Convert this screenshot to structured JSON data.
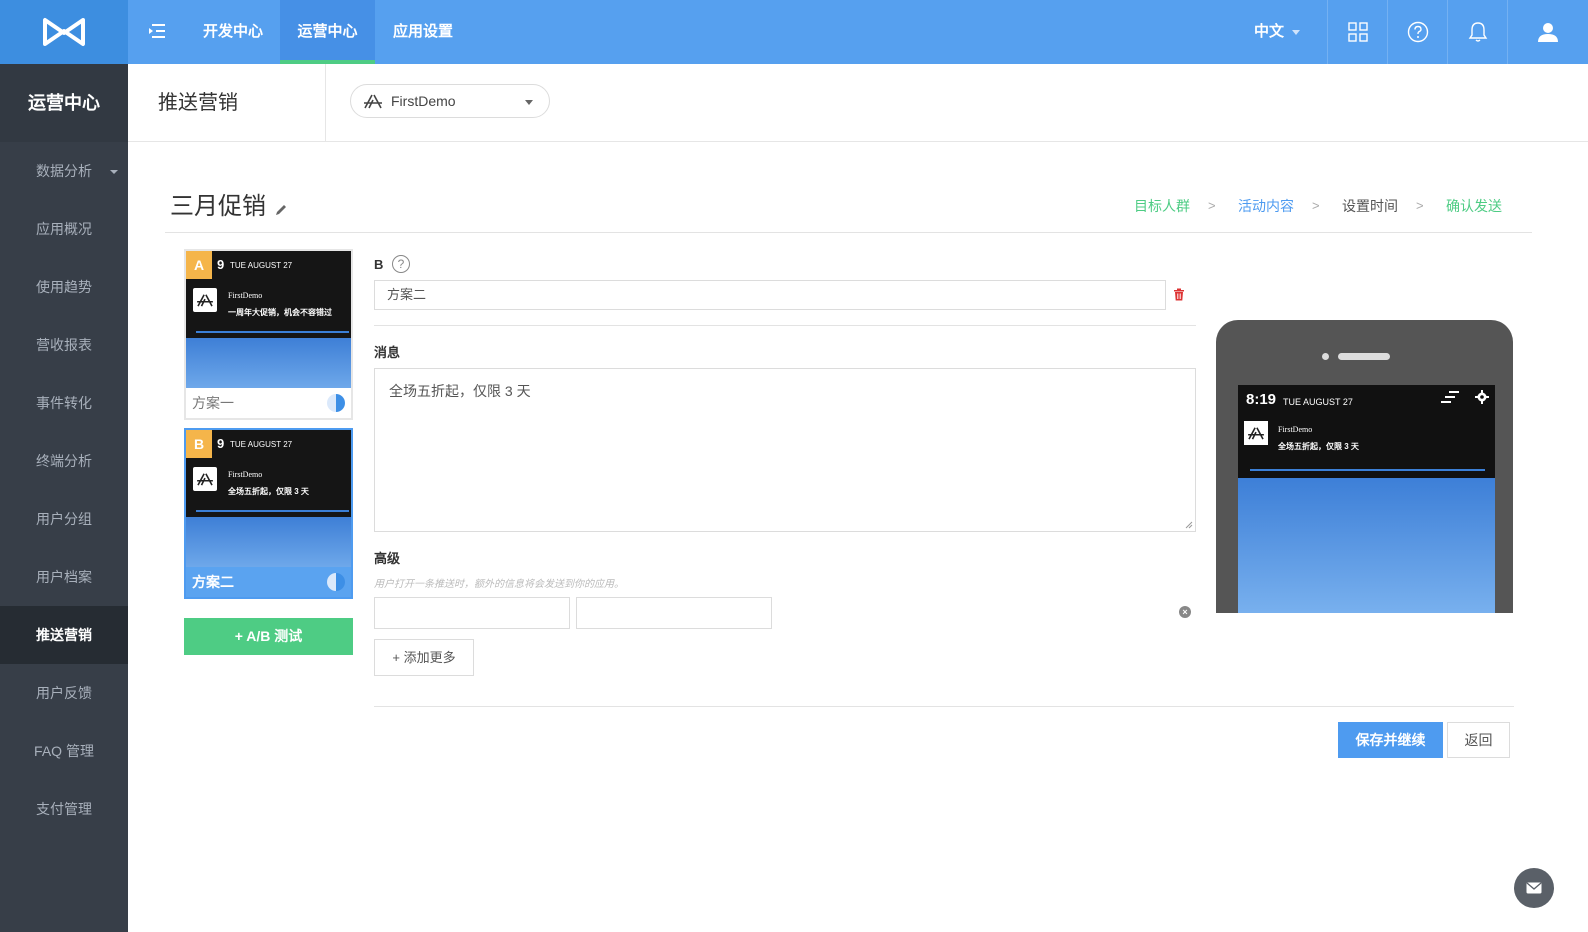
{
  "topnav": {
    "items": [
      "开发中心",
      "运营中心",
      "应用设置"
    ],
    "language": "中文"
  },
  "sidebar": {
    "title": "运营中心",
    "items": [
      "数据分析",
      "应用概况",
      "使用趋势",
      "营收报表",
      "事件转化",
      "终端分析",
      "用户分组",
      "用户档案",
      "推送营销",
      "用户反馈",
      "FAQ 管理",
      "支付管理"
    ],
    "active": "推送营销"
  },
  "header": {
    "title": "推送营销",
    "app_name": "FirstDemo"
  },
  "campaign": {
    "title": "三月促销",
    "steps": [
      "目标人群",
      "活动内容",
      "设置时间",
      "确认发送"
    ],
    "step_sep": ">"
  },
  "variants": [
    {
      "badge": "A",
      "time": "9",
      "date": "TUE AUGUST 27",
      "app": "FirstDemo",
      "message": "一周年大促销，机会不容错过",
      "label": "方案一"
    },
    {
      "badge": "B",
      "time": "9",
      "date": "TUE AUGUST 27",
      "app": "FirstDemo",
      "message": "全场五折起，仅限 3 天",
      "label": "方案二"
    }
  ],
  "ab_test_button": "A/B 测试",
  "form": {
    "variant_label": "B",
    "help": "?",
    "name_value": "方案二",
    "message_label": "消息",
    "message_value": "全场五折起，仅限 3 天",
    "advanced_label": "高级",
    "advanced_hint": "用户打开一条推送时，额外的信息将会发送到你的应用。",
    "key_value": "",
    "value_value": "",
    "add_more": "添加更多",
    "save": "保存并继续",
    "back": "返回"
  },
  "preview": {
    "time": "8:19",
    "date": "TUE AUGUST 27",
    "app": "FirstDemo",
    "message": "全场五折起，仅限 3 天"
  },
  "colors": {
    "topbar": "#56a0ef",
    "sidebar": "#373e48",
    "accent_green": "#4ecc84",
    "accent_blue": "#4e9bf0",
    "badge": "#f5b54a"
  }
}
